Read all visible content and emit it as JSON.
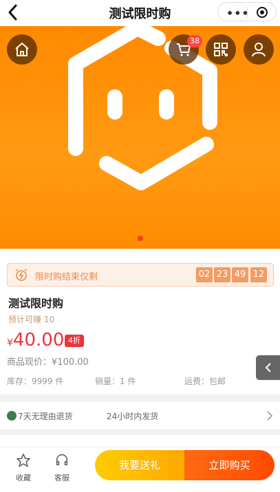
{
  "header": {
    "title": "测试限时购"
  },
  "banner": {
    "cart_count": "38"
  },
  "flash_sale": {
    "label": "限时购结束仅剩",
    "countdown": [
      "02",
      "23",
      "49",
      "12"
    ]
  },
  "product": {
    "name": "测试限时购",
    "earn": "预计可赚 10",
    "currency": "¥",
    "price": "40.00",
    "discount": "4折",
    "original_price": "商品现价：¥100.00",
    "stock": "库存：9999 件",
    "sales": "销量：1 件",
    "shipping": "运费：包邮"
  },
  "service": {
    "return_policy": "7天无理由退货",
    "delivery": "24小时内发货"
  },
  "bottom_bar": {
    "favorite": "收藏",
    "support": "客服",
    "gift_button": "我要送礼",
    "buy_button": "立即购买"
  },
  "colors": {
    "brand_orange": "#ff8a00",
    "price_red": "#e8353b",
    "countdown_bg": "#f49b62"
  }
}
